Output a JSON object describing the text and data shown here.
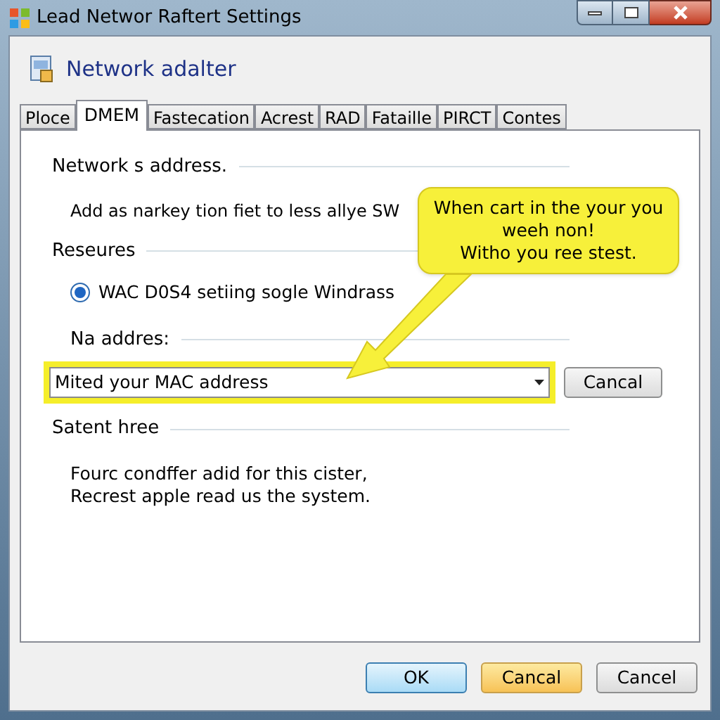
{
  "window": {
    "title": "Lead Networ Raftert Settings"
  },
  "header": {
    "title": "Network adalter"
  },
  "tabs": [
    {
      "label": "Ploce",
      "selected": false
    },
    {
      "label": "DMEM",
      "selected": true
    },
    {
      "label": "Fastecation",
      "selected": false
    },
    {
      "label": "Acrest",
      "selected": false
    },
    {
      "label": "RAD",
      "selected": false
    },
    {
      "label": "Fataille",
      "selected": false
    },
    {
      "label": "PIRCT",
      "selected": false
    },
    {
      "label": "Contes",
      "selected": false
    }
  ],
  "sections": [
    {
      "heading": "Network s address.",
      "text": "Add as narkey tion fiet to less allye SW"
    },
    {
      "heading": "Reseures",
      "radio": {
        "label": "WAC D0S4 setiing sogle Windrass",
        "checked": true
      }
    },
    {
      "heading": "Na addres:"
    }
  ],
  "dropdown": {
    "value": "Mited your MAC address",
    "highlighted": true
  },
  "side_button": "Cancal",
  "callout": {
    "lines": [
      "When cart in the your you",
      "weeh non!",
      "Witho you ree stest."
    ]
  },
  "footer_section": {
    "heading": "Satent hree",
    "lines": [
      "Fourc condffer adid for this cister,",
      "Recrest apple read us the system."
    ]
  },
  "buttons": [
    {
      "label": "OK",
      "kind": "default"
    },
    {
      "label": "Cancal",
      "kind": "hover"
    },
    {
      "label": "Cancel",
      "kind": "normal"
    }
  ]
}
